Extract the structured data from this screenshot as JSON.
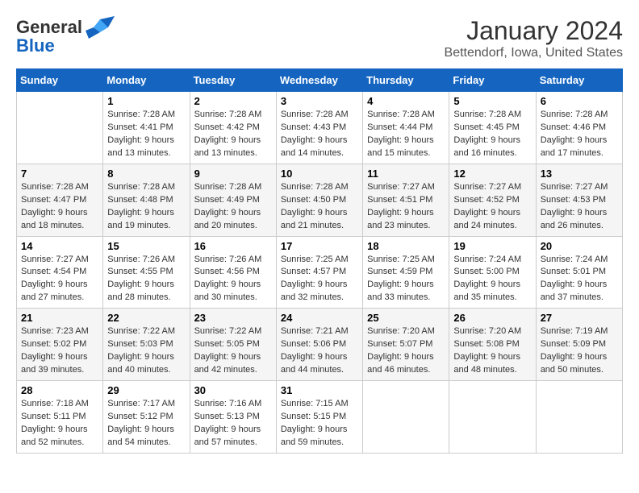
{
  "logo": {
    "line1": "General",
    "line2": "Blue"
  },
  "title": "January 2024",
  "subtitle": "Bettendorf, Iowa, United States",
  "days_of_week": [
    "Sunday",
    "Monday",
    "Tuesday",
    "Wednesday",
    "Thursday",
    "Friday",
    "Saturday"
  ],
  "weeks": [
    [
      {
        "day": "",
        "sunrise": "",
        "sunset": "",
        "daylight": ""
      },
      {
        "day": "1",
        "sunrise": "Sunrise: 7:28 AM",
        "sunset": "Sunset: 4:41 PM",
        "daylight": "Daylight: 9 hours and 13 minutes."
      },
      {
        "day": "2",
        "sunrise": "Sunrise: 7:28 AM",
        "sunset": "Sunset: 4:42 PM",
        "daylight": "Daylight: 9 hours and 13 minutes."
      },
      {
        "day": "3",
        "sunrise": "Sunrise: 7:28 AM",
        "sunset": "Sunset: 4:43 PM",
        "daylight": "Daylight: 9 hours and 14 minutes."
      },
      {
        "day": "4",
        "sunrise": "Sunrise: 7:28 AM",
        "sunset": "Sunset: 4:44 PM",
        "daylight": "Daylight: 9 hours and 15 minutes."
      },
      {
        "day": "5",
        "sunrise": "Sunrise: 7:28 AM",
        "sunset": "Sunset: 4:45 PM",
        "daylight": "Daylight: 9 hours and 16 minutes."
      },
      {
        "day": "6",
        "sunrise": "Sunrise: 7:28 AM",
        "sunset": "Sunset: 4:46 PM",
        "daylight": "Daylight: 9 hours and 17 minutes."
      }
    ],
    [
      {
        "day": "7",
        "sunrise": "Sunrise: 7:28 AM",
        "sunset": "Sunset: 4:47 PM",
        "daylight": "Daylight: 9 hours and 18 minutes."
      },
      {
        "day": "8",
        "sunrise": "Sunrise: 7:28 AM",
        "sunset": "Sunset: 4:48 PM",
        "daylight": "Daylight: 9 hours and 19 minutes."
      },
      {
        "day": "9",
        "sunrise": "Sunrise: 7:28 AM",
        "sunset": "Sunset: 4:49 PM",
        "daylight": "Daylight: 9 hours and 20 minutes."
      },
      {
        "day": "10",
        "sunrise": "Sunrise: 7:28 AM",
        "sunset": "Sunset: 4:50 PM",
        "daylight": "Daylight: 9 hours and 21 minutes."
      },
      {
        "day": "11",
        "sunrise": "Sunrise: 7:27 AM",
        "sunset": "Sunset: 4:51 PM",
        "daylight": "Daylight: 9 hours and 23 minutes."
      },
      {
        "day": "12",
        "sunrise": "Sunrise: 7:27 AM",
        "sunset": "Sunset: 4:52 PM",
        "daylight": "Daylight: 9 hours and 24 minutes."
      },
      {
        "day": "13",
        "sunrise": "Sunrise: 7:27 AM",
        "sunset": "Sunset: 4:53 PM",
        "daylight": "Daylight: 9 hours and 26 minutes."
      }
    ],
    [
      {
        "day": "14",
        "sunrise": "Sunrise: 7:27 AM",
        "sunset": "Sunset: 4:54 PM",
        "daylight": "Daylight: 9 hours and 27 minutes."
      },
      {
        "day": "15",
        "sunrise": "Sunrise: 7:26 AM",
        "sunset": "Sunset: 4:55 PM",
        "daylight": "Daylight: 9 hours and 28 minutes."
      },
      {
        "day": "16",
        "sunrise": "Sunrise: 7:26 AM",
        "sunset": "Sunset: 4:56 PM",
        "daylight": "Daylight: 9 hours and 30 minutes."
      },
      {
        "day": "17",
        "sunrise": "Sunrise: 7:25 AM",
        "sunset": "Sunset: 4:57 PM",
        "daylight": "Daylight: 9 hours and 32 minutes."
      },
      {
        "day": "18",
        "sunrise": "Sunrise: 7:25 AM",
        "sunset": "Sunset: 4:59 PM",
        "daylight": "Daylight: 9 hours and 33 minutes."
      },
      {
        "day": "19",
        "sunrise": "Sunrise: 7:24 AM",
        "sunset": "Sunset: 5:00 PM",
        "daylight": "Daylight: 9 hours and 35 minutes."
      },
      {
        "day": "20",
        "sunrise": "Sunrise: 7:24 AM",
        "sunset": "Sunset: 5:01 PM",
        "daylight": "Daylight: 9 hours and 37 minutes."
      }
    ],
    [
      {
        "day": "21",
        "sunrise": "Sunrise: 7:23 AM",
        "sunset": "Sunset: 5:02 PM",
        "daylight": "Daylight: 9 hours and 39 minutes."
      },
      {
        "day": "22",
        "sunrise": "Sunrise: 7:22 AM",
        "sunset": "Sunset: 5:03 PM",
        "daylight": "Daylight: 9 hours and 40 minutes."
      },
      {
        "day": "23",
        "sunrise": "Sunrise: 7:22 AM",
        "sunset": "Sunset: 5:05 PM",
        "daylight": "Daylight: 9 hours and 42 minutes."
      },
      {
        "day": "24",
        "sunrise": "Sunrise: 7:21 AM",
        "sunset": "Sunset: 5:06 PM",
        "daylight": "Daylight: 9 hours and 44 minutes."
      },
      {
        "day": "25",
        "sunrise": "Sunrise: 7:20 AM",
        "sunset": "Sunset: 5:07 PM",
        "daylight": "Daylight: 9 hours and 46 minutes."
      },
      {
        "day": "26",
        "sunrise": "Sunrise: 7:20 AM",
        "sunset": "Sunset: 5:08 PM",
        "daylight": "Daylight: 9 hours and 48 minutes."
      },
      {
        "day": "27",
        "sunrise": "Sunrise: 7:19 AM",
        "sunset": "Sunset: 5:09 PM",
        "daylight": "Daylight: 9 hours and 50 minutes."
      }
    ],
    [
      {
        "day": "28",
        "sunrise": "Sunrise: 7:18 AM",
        "sunset": "Sunset: 5:11 PM",
        "daylight": "Daylight: 9 hours and 52 minutes."
      },
      {
        "day": "29",
        "sunrise": "Sunrise: 7:17 AM",
        "sunset": "Sunset: 5:12 PM",
        "daylight": "Daylight: 9 hours and 54 minutes."
      },
      {
        "day": "30",
        "sunrise": "Sunrise: 7:16 AM",
        "sunset": "Sunset: 5:13 PM",
        "daylight": "Daylight: 9 hours and 57 minutes."
      },
      {
        "day": "31",
        "sunrise": "Sunrise: 7:15 AM",
        "sunset": "Sunset: 5:15 PM",
        "daylight": "Daylight: 9 hours and 59 minutes."
      },
      {
        "day": "",
        "sunrise": "",
        "sunset": "",
        "daylight": ""
      },
      {
        "day": "",
        "sunrise": "",
        "sunset": "",
        "daylight": ""
      },
      {
        "day": "",
        "sunrise": "",
        "sunset": "",
        "daylight": ""
      }
    ]
  ]
}
